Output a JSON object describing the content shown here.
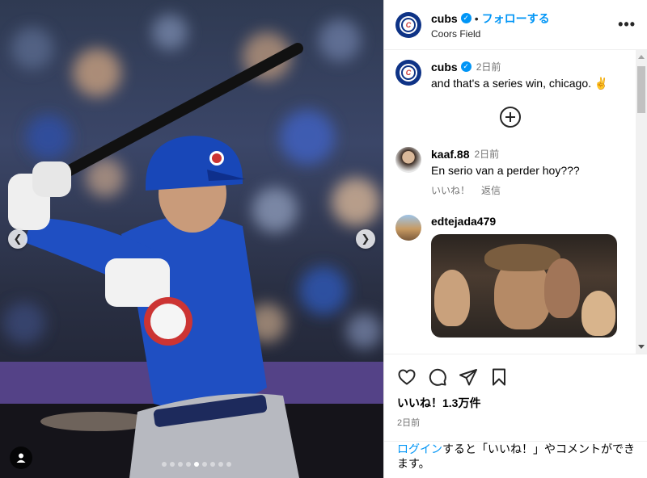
{
  "header": {
    "username": "cubs",
    "separator": "•",
    "follow_label": "フォローする",
    "location": "Coors Field",
    "more_label": "•••",
    "avatar_letter": "C"
  },
  "caption": {
    "username": "cubs",
    "time": "2日前",
    "text": "and that's a series win, chicago. ✌️"
  },
  "comments": [
    {
      "username": "kaaf.88",
      "time": "2日前",
      "text": "En serio van a perder hoy???",
      "like_label": "いいね！",
      "reply_label": "返信"
    },
    {
      "username": "edtejada479",
      "time": "",
      "text": ""
    }
  ],
  "actions": {
    "like_icon": "heart-icon",
    "comment_icon": "comment-icon",
    "share_icon": "paper-plane-icon",
    "save_icon": "bookmark-icon"
  },
  "likes": "いいね！1.3万件",
  "date": "2日前",
  "login": {
    "link": "ログイン",
    "text": "すると「いいね！」やコメントができます。"
  },
  "media": {
    "carousel_count": 9,
    "active_index": 4,
    "prev_icon": "chevron-left-icon",
    "next_icon": "chevron-right-icon",
    "tag_icon": "user-icon"
  },
  "colors": {
    "accent": "#0095f6",
    "cubs_blue": "#0e3386",
    "cubs_red": "#cc3433"
  }
}
